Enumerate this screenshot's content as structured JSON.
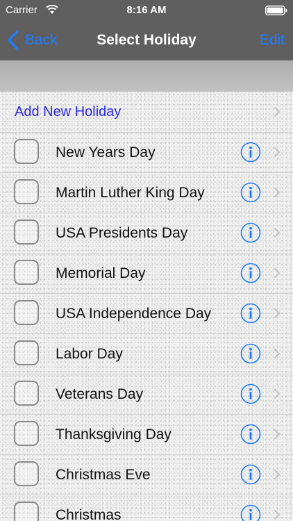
{
  "status_bar": {
    "carrier": "Carrier",
    "time": "8:16 AM",
    "wifi_icon": "wifi-icon",
    "battery_icon": "battery-icon"
  },
  "nav": {
    "back_label": "Back",
    "title": "Select Holiday",
    "edit_label": "Edit"
  },
  "list": {
    "add_label": "Add New Holiday",
    "items": [
      {
        "label": "New Years Day",
        "checked": false
      },
      {
        "label": "Martin Luther King Day",
        "checked": false
      },
      {
        "label": "USA Presidents Day",
        "checked": false
      },
      {
        "label": "Memorial Day",
        "checked": false
      },
      {
        "label": "USA Independence Day",
        "checked": false
      },
      {
        "label": "Labor Day",
        "checked": false
      },
      {
        "label": "Veterans Day",
        "checked": false
      },
      {
        "label": "Thanksgiving Day",
        "checked": false
      },
      {
        "label": "Christmas Eve",
        "checked": false
      },
      {
        "label": "Christmas",
        "checked": false
      }
    ]
  },
  "colors": {
    "nav_background": "#5f5f5f",
    "accent_blue": "#1e7cff",
    "add_link_blue": "#2a2ae0",
    "info_blue": "#1e7cff",
    "chevron_gray": "#c4c4c4"
  }
}
